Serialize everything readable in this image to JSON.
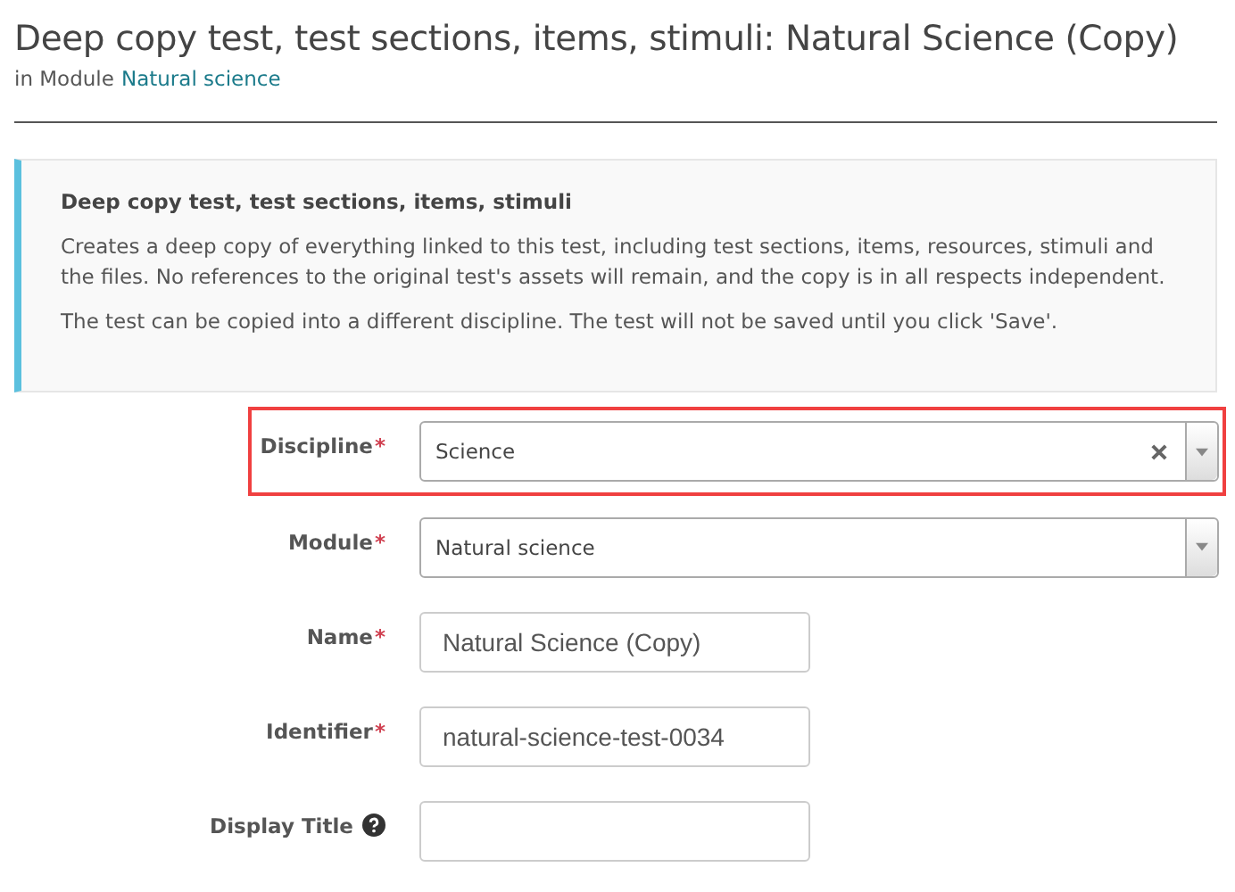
{
  "header": {
    "title": "Deep copy test, test sections, items, stimuli: Natural Science (Copy)",
    "subtitle_prefix": "in Module",
    "subtitle_link": "Natural science"
  },
  "info": {
    "title": "Deep copy test, test sections, items, stimuli",
    "paragraphs": [
      "Creates a deep copy of everything linked to this test, including test sections, items, resources, stimuli and the files. No references to the original test's assets will remain, and the copy is in all respects independent.",
      "The test can be copied into a different discipline. The test will not be saved until you click 'Save'."
    ]
  },
  "fields": [
    {
      "label": "Discipline",
      "required_mark": "*",
      "kind": "select",
      "value": "Science",
      "clearable": true,
      "highlighted": true
    },
    {
      "label": "Module",
      "required_mark": "*",
      "kind": "select",
      "value": "Natural science",
      "clearable": false,
      "highlighted": false
    },
    {
      "label": "Name",
      "required_mark": "*",
      "kind": "text",
      "value": "Natural Science (Copy)",
      "highlighted": false
    },
    {
      "label": "Identifier",
      "required_mark": "*",
      "kind": "text",
      "value": "natural-science-test-0034",
      "highlighted": false
    },
    {
      "label": "Display Title",
      "help": true,
      "kind": "text",
      "highlighted": false
    }
  ]
}
